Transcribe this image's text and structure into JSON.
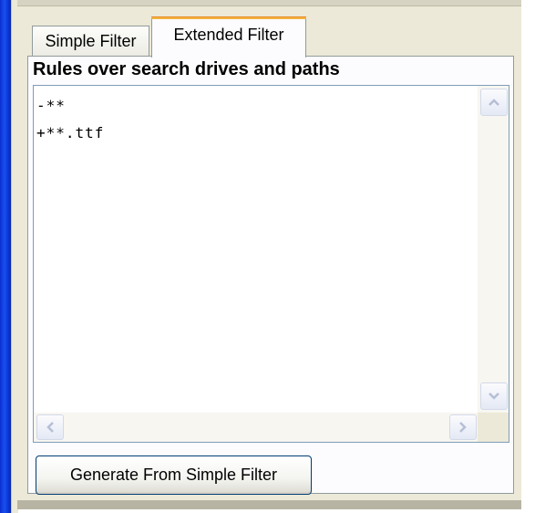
{
  "tabs": {
    "simple_label": "Simple Filter",
    "extended_label": "Extended Filter",
    "active": "Extended Filter"
  },
  "rules": {
    "heading": "Rules over search drives and paths",
    "text": "-**\n+**.ttf"
  },
  "buttons": {
    "generate_label": "Generate From Simple Filter"
  },
  "colors": {
    "window_border": "#0b34d6",
    "panel": "#ece9d8",
    "active_tab_highlight": "#f3b33d",
    "control_border": "#7f9db9",
    "button_border": "#003c74"
  },
  "icons": {
    "scroll_up": "chevron-up-icon",
    "scroll_down": "chevron-down-icon",
    "scroll_left": "chevron-left-icon",
    "scroll_right": "chevron-right-icon"
  }
}
